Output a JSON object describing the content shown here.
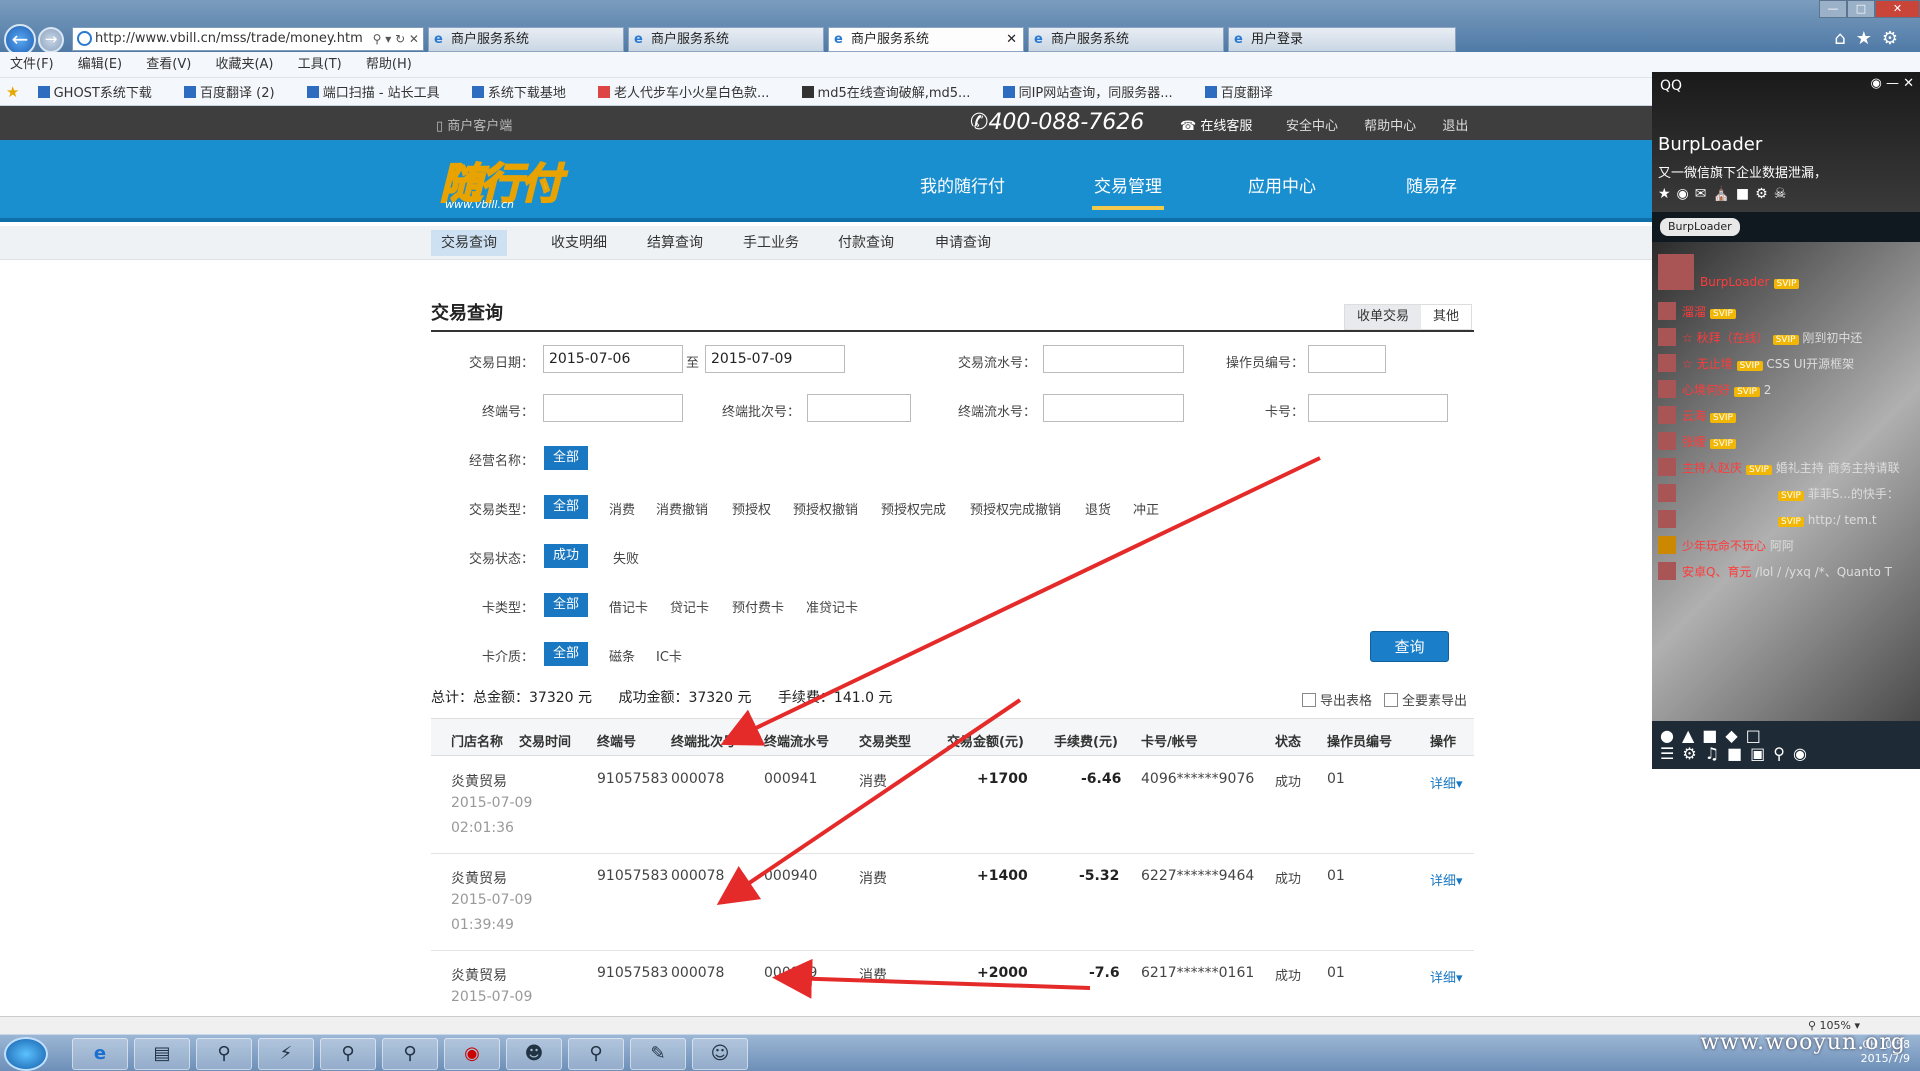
{
  "browser": {
    "url": "http://www.vbill.cn/mss/trade/money.htm",
    "tabs": [
      "商户服务系统",
      "商户服务系统",
      "商户服务系统",
      "商户服务系统",
      "用户登录"
    ],
    "menu": [
      "文件(F)",
      "编辑(E)",
      "查看(V)",
      "收藏夹(A)",
      "工具(T)",
      "帮助(H)"
    ],
    "favorites": [
      "GHOST系统下载",
      "百度翻译 (2)",
      "端口扫描 - 站长工具",
      "系统下载基地",
      "老人代步车小火星白色款...",
      "md5在线查询破解,md5...",
      "同IP网站查询，同服务器...",
      "百度翻译"
    ],
    "zoom": "105%"
  },
  "site": {
    "client_label": "商户客户端",
    "phone": "400-088-7626",
    "service_label": "在线客服",
    "top_links": [
      "安全中心",
      "帮助中心",
      "退出"
    ],
    "logo": "随行付",
    "logo_sub": "www.vbill.cn",
    "main_nav": [
      "我的随行付",
      "交易管理",
      "应用中心",
      "随易存"
    ],
    "main_nav_active": "交易管理",
    "sub_nav": [
      "交易查询",
      "收支明细",
      "结算查询",
      "手工业务",
      "付款查询",
      "申请查询"
    ],
    "sub_nav_active": "交易查询",
    "accent": "#1a8fd0"
  },
  "page": {
    "title": "交易查询",
    "right_tabs": [
      "收单交易",
      "其他"
    ]
  },
  "form": {
    "date_label": "交易日期：",
    "date_from": "2015-07-06",
    "date_sep": "至",
    "date_to": "2015-07-09",
    "serial_label": "交易流水号：",
    "operator_label": "操作员编号：",
    "terminal_label": "终端号：",
    "batch_label": "终端批次号：",
    "term_serial_label": "终端流水号：",
    "card_label": "卡号：",
    "biz_name_label": "经营名称：",
    "biz_name_opts": [
      "全部"
    ],
    "type_label": "交易类型：",
    "type_opts": [
      "全部",
      "消费",
      "消费撤销",
      "预授权",
      "预授权撤销",
      "预授权完成",
      "预授权完成撤销",
      "退货",
      "冲正"
    ],
    "status_label": "交易状态：",
    "status_opts": [
      "成功",
      "失败"
    ],
    "cardtype_label": "卡类型：",
    "cardtype_opts": [
      "全部",
      "借记卡",
      "贷记卡",
      "预付费卡",
      "准贷记卡"
    ],
    "medium_label": "卡介质：",
    "medium_opts": [
      "全部",
      "磁条",
      "IC卡"
    ],
    "query_button": "查询"
  },
  "summary": {
    "total": "总计：总金额：37320 元",
    "success": "成功金额：37320 元",
    "fee": "手续费：141.0 元",
    "export_table": "导出表格",
    "export_all": "全要素导出"
  },
  "table": {
    "headers": [
      "门店名称",
      "交易时间",
      "终端号",
      "终端批次号",
      "终端流水号",
      "交易类型",
      "交易金额(元)",
      "手续费(元)",
      "卡号/帐号",
      "状态",
      "操作员编号",
      "操作"
    ],
    "rows": [
      {
        "store": "炎黄贸易",
        "date": "2015-07-09",
        "time": "02:01:36",
        "terminal": "91057583",
        "batch": "000078",
        "serial": "000941",
        "type": "消费",
        "amount": "+1700",
        "fee": "-6.46",
        "card": "4096******9076",
        "status": "成功",
        "operator": "01",
        "action": "详细"
      },
      {
        "store": "炎黄贸易",
        "date": "2015-07-09",
        "time": "01:39:49",
        "terminal": "91057583",
        "batch": "000078",
        "serial": "000940",
        "type": "消费",
        "amount": "+1400",
        "fee": "-5.32",
        "card": "6227******9464",
        "status": "成功",
        "operator": "01",
        "action": "详细"
      },
      {
        "store": "炎黄贸易",
        "date": "2015-07-09",
        "time": "",
        "terminal": "91057583",
        "batch": "000078",
        "serial": "000939",
        "type": "消费",
        "amount": "+2000",
        "fee": "-7.6",
        "card": "6217******0161",
        "status": "成功",
        "operator": "01",
        "action": "详细"
      }
    ]
  },
  "qq": {
    "title": "QQ",
    "name": "BurpLoader",
    "signature": "又一微信旗下企业数据泄漏，",
    "tag": "BurpLoader",
    "feed": [
      {
        "name": "BurpLoader",
        "text": ""
      },
      {
        "name": "",
        "text": ""
      },
      {
        "name": "溜溜",
        "text": ""
      },
      {
        "name": "秋拜（在线）",
        "text": "刚到初中还"
      },
      {
        "name": "无止境",
        "text": "CSS UI开源框架"
      },
      {
        "name": "心境何好",
        "text": "2"
      },
      {
        "name": "云海",
        "text": ""
      },
      {
        "name": "张暧",
        "text": ""
      },
      {
        "name": "主持人赵庆",
        "text": "婚礼主持 商务主持请联"
      },
      {
        "name": "",
        "text": "菲菲S...的快手："
      },
      {
        "name": "",
        "text": "http:/ tem.t"
      },
      {
        "name": "少年玩命不玩心",
        "text": "阿阿"
      },
      {
        "name": "安卓Q、育元",
        "text": "/lol / /yxq /*、Quanto T"
      }
    ]
  },
  "tray": {
    "time": "0:58",
    "date": "2015/7/9",
    "lang": "CH"
  },
  "watermark": "www.wooyun.org"
}
